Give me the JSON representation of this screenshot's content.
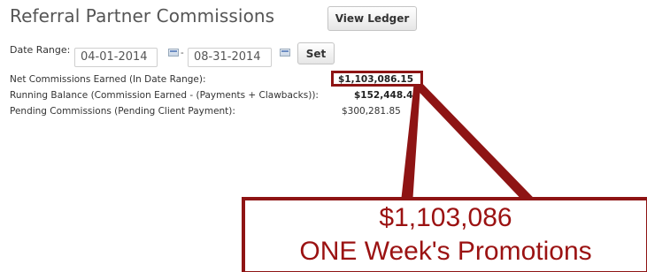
{
  "header": {
    "title": "Referral Partner Commissions",
    "view_ledger_label": "View Ledger"
  },
  "date_range": {
    "label": "Date Range:",
    "from_value": "04-01-2014",
    "separator": "-",
    "to_value": "08-31-2014",
    "set_label": "Set"
  },
  "summary": {
    "rows": [
      {
        "label": "Net Commissions Earned (In Date Range):",
        "value": "$1,103,086.15"
      },
      {
        "label": "Running Balance (Commission Earned - (Payments + Clawbacks)):",
        "value": "$152,448.45"
      },
      {
        "label": "Pending Commissions (Pending Client Payment):",
        "value": "$300,281.85"
      }
    ]
  },
  "annotation": {
    "amount": "$1,103,086",
    "caption": "ONE Week's Promotions",
    "accent_color": "#8e1414",
    "text_color": "#9b1212"
  },
  "icons": {
    "calendar": "calendar-icon"
  }
}
